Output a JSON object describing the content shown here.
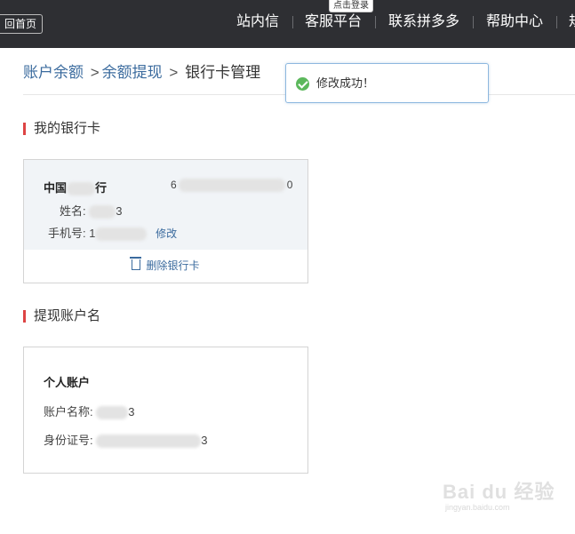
{
  "topbar": {
    "back_home": "回首页",
    "login_badge": "点击登录",
    "nav": [
      "站内信",
      "客服平台",
      "联系拼多多",
      "帮助中心",
      "规"
    ]
  },
  "breadcrumb": {
    "items": [
      "账户余额",
      "余额提现"
    ],
    "separator": ">",
    "current": "银行卡管理"
  },
  "toast": {
    "message": "修改成功！"
  },
  "bank_section": {
    "title": "我的银行卡",
    "bank_name_prefix": "中国",
    "bank_name_suffix": "行",
    "card_number_prefix": "6",
    "card_number_suffix": "0",
    "name_label": "姓名:",
    "name_suffix": "3",
    "phone_label": "手机号:",
    "phone_prefix": "1",
    "edit_label": "修改",
    "delete_label": "删除银行卡"
  },
  "account_section": {
    "title": "提现账户名",
    "account_type": "个人账户",
    "account_name_label": "账户名称:",
    "account_name_suffix": "3",
    "id_label": "身份证号:",
    "id_suffix": "3"
  },
  "watermark": {
    "main": "Bai du 经验",
    "sub": "jingyan.baidu.com"
  },
  "colors": {
    "topbar": "#2e2f33",
    "link": "#3b6b9e",
    "accent_bar": "#dd4444",
    "success": "#5cb85c"
  }
}
